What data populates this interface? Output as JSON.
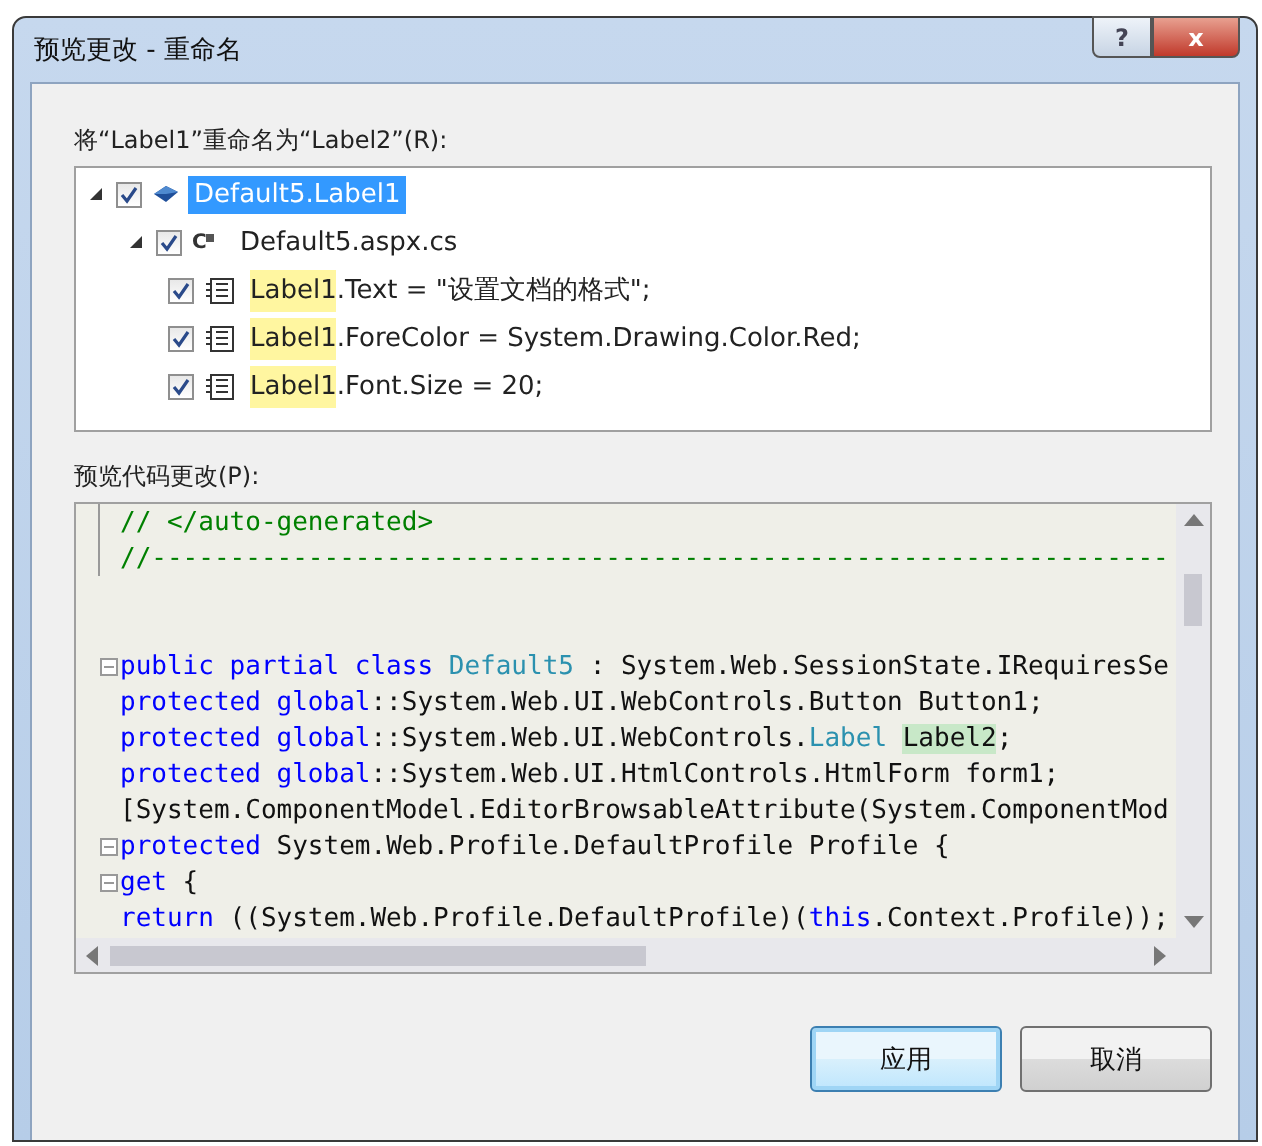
{
  "window": {
    "title": "预览更改 - 重命名",
    "help_button": "?",
    "close_button": "x"
  },
  "rename_label": "将“Label1”重命名为“Label2”(R):",
  "tree": [
    {
      "kind": "symbol",
      "text": "Default5.Label1",
      "checked": true,
      "expanded": true,
      "selected": true,
      "children": [
        {
          "kind": "file",
          "icon_label": "C",
          "text": "Default5.aspx.cs",
          "checked": true,
          "expanded": true,
          "selected": false,
          "children": [
            {
              "kind": "change",
              "match": "Label1",
              "text": ".Text = \"设置文档的格式\";",
              "checked": true,
              "selected": false
            },
            {
              "kind": "change",
              "match": "Label1",
              "text": ".ForeColor = System.Drawing.Color.Red;",
              "checked": true,
              "selected": false
            },
            {
              "kind": "change",
              "match": "Label1",
              "text": ".Font.Size = 20;",
              "checked": true,
              "selected": false
            }
          ]
        }
      ]
    }
  ],
  "preview_label": "预览代码更改(P):",
  "code_lines": [
    {
      "outline": true,
      "collapsible": false,
      "tokens": [
        {
          "kind": "comment",
          "text": "// </auto-generated>"
        }
      ]
    },
    {
      "outline": true,
      "collapsible": false,
      "tokens": [
        {
          "kind": "comment",
          "text": "//-----------------------------------------------------------------"
        }
      ]
    },
    {
      "outline": false,
      "collapsible": false
    },
    {
      "outline": false,
      "collapsible": false
    },
    {
      "outline": false,
      "collapsible": true,
      "tokens": [
        {
          "kind": "keyword",
          "text": "public partial class "
        },
        {
          "kind": "type",
          "text": "Default5"
        },
        {
          "kind": "plain",
          "text": " : System.Web.SessionState.IRequiresSe"
        }
      ]
    },
    {
      "outline": false,
      "collapsible": false,
      "tokens": [
        {
          "kind": "keyword",
          "text": "protected global"
        },
        {
          "kind": "plain",
          "text": "::System.Web.UI.WebControls.Button Button1;"
        }
      ]
    },
    {
      "outline": false,
      "collapsible": false,
      "tokens": [
        {
          "kind": "keyword",
          "text": "protected global"
        },
        {
          "kind": "plain",
          "text": "::System.Web.UI.WebControls."
        },
        {
          "kind": "type",
          "text": "Label "
        },
        {
          "kind": "highlight",
          "text": "Label2"
        },
        {
          "kind": "plain",
          "text": ";"
        }
      ]
    },
    {
      "outline": false,
      "collapsible": false,
      "tokens": [
        {
          "kind": "keyword",
          "text": "protected global"
        },
        {
          "kind": "plain",
          "text": "::System.Web.UI.HtmlControls.HtmlForm form1;"
        }
      ]
    },
    {
      "outline": false,
      "collapsible": false,
      "tokens": [
        {
          "kind": "plain",
          "text": "[System.ComponentModel.EditorBrowsableAttribute(System.ComponentMod"
        }
      ]
    },
    {
      "outline": false,
      "collapsible": true,
      "tokens": [
        {
          "kind": "keyword",
          "text": "protected"
        },
        {
          "kind": "plain",
          "text": " System.Web.Profile.DefaultProfile Profile {"
        }
      ]
    },
    {
      "outline": false,
      "collapsible": true,
      "tokens": [
        {
          "kind": "keyword",
          "text": "get"
        },
        {
          "kind": "plain",
          "text": " {"
        }
      ]
    },
    {
      "outline": false,
      "collapsible": false,
      "tokens": [
        {
          "kind": "keyword",
          "text": "return"
        },
        {
          "kind": "plain",
          "text": " ((System.Web.Profile.DefaultProfile)("
        },
        {
          "kind": "keyword",
          "text": "this"
        },
        {
          "kind": "plain",
          "text": ".Context.Profile));"
        }
      ]
    }
  ],
  "buttons": [
    {
      "label": "应用",
      "default": true
    },
    {
      "label": "取消",
      "default": false
    }
  ]
}
